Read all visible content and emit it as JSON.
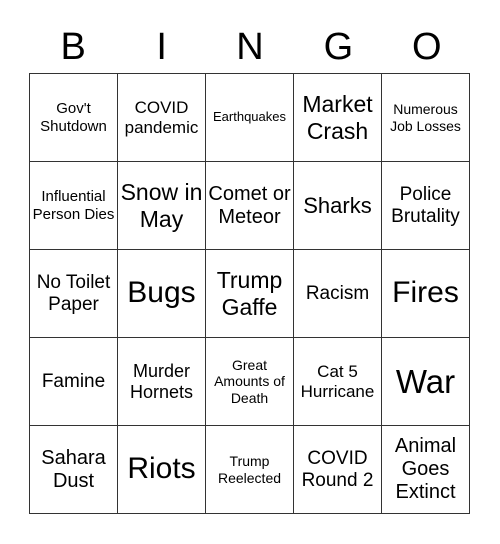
{
  "header": {
    "letters": [
      "B",
      "I",
      "N",
      "G",
      "O"
    ]
  },
  "cells": [
    [
      "Gov't Shutdown",
      "COVID pandemic",
      "Earthquakes",
      "Market Crash",
      "Numerous Job Losses"
    ],
    [
      "Influential Person Dies",
      "Snow in May",
      "Comet or Meteor",
      "Sharks",
      "Police Brutality"
    ],
    [
      "No Toilet Paper",
      "Bugs",
      "Trump Gaffe",
      "Racism",
      "Fires"
    ],
    [
      "Famine",
      "Murder Hornets",
      "Great Amounts of Death",
      "Cat 5 Hurricane",
      "War"
    ],
    [
      "Sahara Dust",
      "Riots",
      "Trump Reelected",
      "COVID Round 2",
      "Animal Goes Extinct"
    ]
  ]
}
